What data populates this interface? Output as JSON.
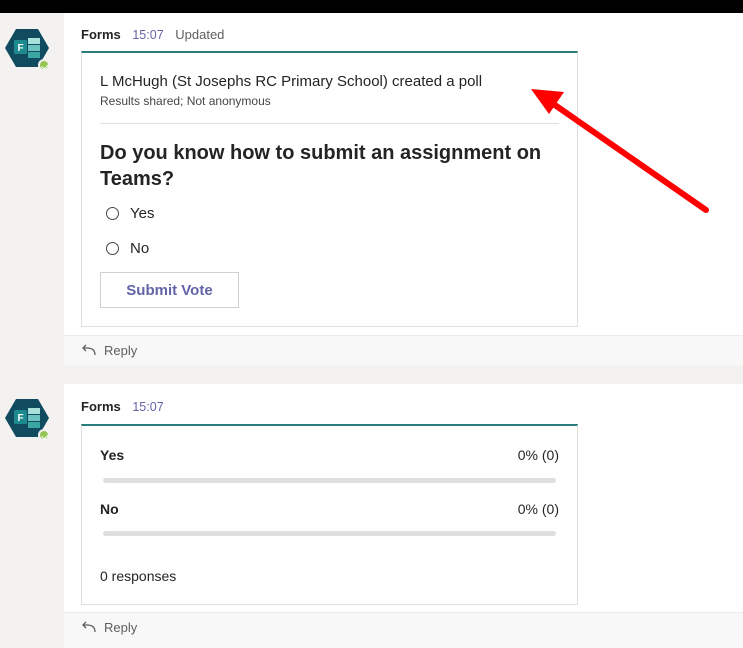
{
  "message1": {
    "sender": "Forms",
    "time": "15:07",
    "status": "Updated",
    "poll": {
      "creator_line": "L McHugh (St Josephs RC Primary School) created a poll",
      "meta": "Results shared; Not anonymous",
      "question": "Do you know how to submit an assignment on Teams?",
      "options": [
        {
          "label": "Yes"
        },
        {
          "label": "No"
        }
      ],
      "submit_label": "Submit Vote"
    },
    "reply_label": "Reply"
  },
  "message2": {
    "sender": "Forms",
    "time": "15:07",
    "results": [
      {
        "label": "Yes",
        "value_text": "0% (0)",
        "fraction": 0
      },
      {
        "label": "No",
        "value_text": "0% (0)",
        "fraction": 0
      }
    ],
    "responses": "0 responses",
    "reply_label": "Reply"
  },
  "colors": {
    "accent": "#6264a7",
    "card_top_border": "#2a7d7d",
    "annotation_arrow": "#ff0000",
    "presence_available": "#92c353"
  },
  "icons": {
    "avatar": "microsoft-forms-icon",
    "reply": "reply-arrow-icon"
  }
}
